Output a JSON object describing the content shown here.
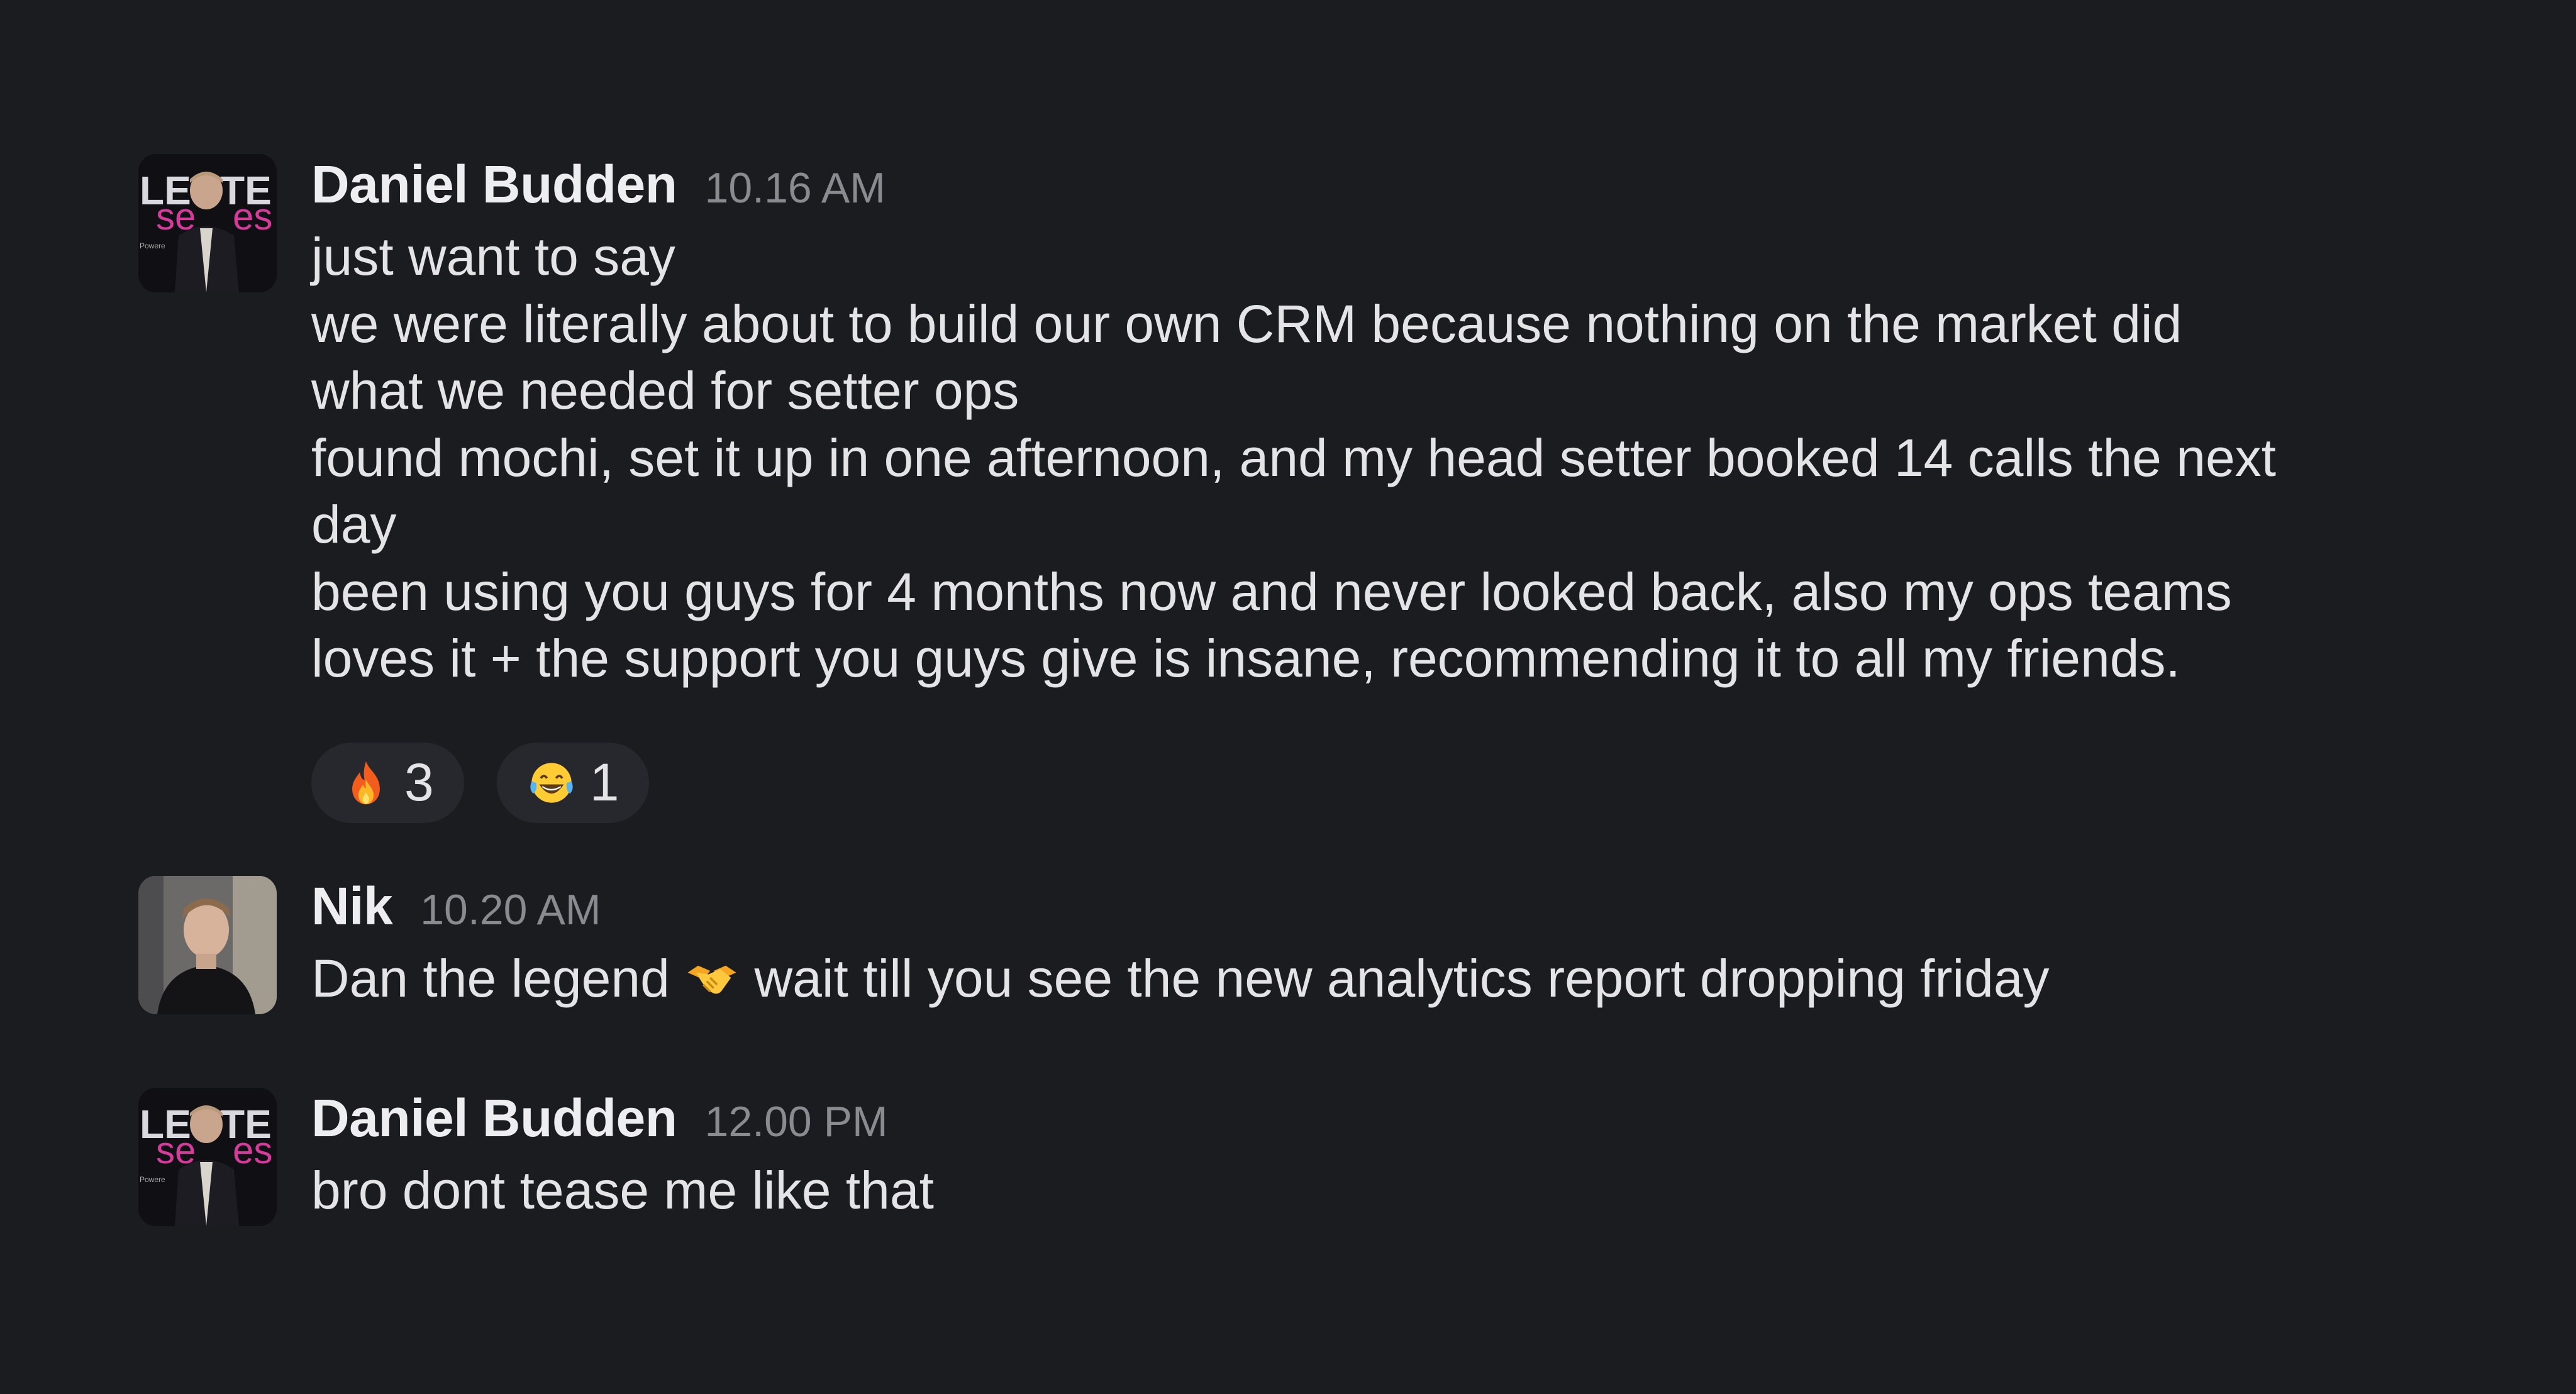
{
  "messages": [
    {
      "author": "Daniel Budden",
      "time": "10.16 AM",
      "avatar_icon": "avatar-daniel-budden",
      "lines": [
        "just want to say",
        "we were literally about to build our own CRM because nothing on the market did",
        "what we needed for setter ops",
        "found mochi, set it up in one afternoon, and my head setter booked 14 calls the next",
        "day",
        "been using you guys for 4 months now and never looked back, also my ops teams",
        "loves it + the support you guys give is insane, recommending it to all my friends."
      ],
      "reactions": [
        {
          "emoji_icon": "fire-emoji-icon",
          "count": "3"
        },
        {
          "emoji_icon": "laughing-tears-emoji-icon",
          "count": "1"
        }
      ]
    },
    {
      "author": "Nik",
      "time": "10.20 AM",
      "avatar_icon": "avatar-nik",
      "text_before_emoji": "Dan the legend",
      "inline_emoji_icon": "handshake-emoji-icon",
      "text_after_emoji": "wait till you see the new analytics report dropping friday"
    },
    {
      "author": "Daniel Budden",
      "time": "12.00 PM",
      "avatar_icon": "avatar-daniel-budden",
      "lines": [
        "bro dont tease me like that"
      ]
    }
  ],
  "colors": {
    "background": "#1b1c20",
    "author": "#eeeef0",
    "timestamp": "#8a8b90",
    "reaction_pill": "#27282d",
    "avatar_brand_magenta": "#d63b9b"
  }
}
